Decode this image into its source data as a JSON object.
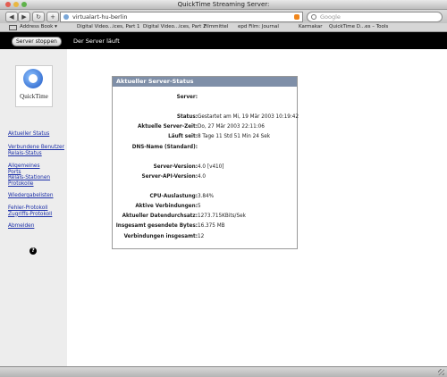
{
  "window": {
    "title": "QuickTime Streaming Server:"
  },
  "toolbar": {
    "back": "◀",
    "forward": "▶",
    "reload": "↻",
    "add": "+",
    "url": "virtualart-hu-berlin",
    "search_placeholder": "Google"
  },
  "bookmarks": [
    "Address Book ▾",
    "Digital Video...ices, Part 1",
    "Digital Video...ices, Part 2",
    "Filmmittel",
    "epd Film: Journal",
    "Karmakar",
    "QuickTime D...es – Tools"
  ],
  "header": {
    "stop_button": "Server stoppen",
    "status_text": "Der Server läuft"
  },
  "sidebar": {
    "logo_text": "QuickTime",
    "links": [
      "Aktueller Status",
      "Verbundene Benutzer",
      "Relais-Status",
      "Allgemeines",
      "Ports",
      "Relais-Stationen",
      "Protokolle",
      "Wiedergabelisten",
      "Fehler-Protokoll",
      "Zugriffs-Protokoll",
      "Abmelden"
    ],
    "help": "?"
  },
  "panel": {
    "title": "Aktueller Server-Status",
    "rows": [
      {
        "label": "Server:",
        "value": ""
      },
      {
        "label": "Status:",
        "value": "Gestartet am Mi, 19 Mär 2003 10:19:42"
      },
      {
        "label": "Aktuelle Server-Zeit:",
        "value": "Do, 27 Mär 2003 22:11:06"
      },
      {
        "label": "Läuft seit:",
        "value": "8 Tage 11 Std 51 Min 24 Sek"
      },
      {
        "label": "DNS-Name (Standard):",
        "value": ""
      },
      {
        "label": "Server-Version:",
        "value": "4.0 [v410]"
      },
      {
        "label": "Server-API-Version:",
        "value": "4.0"
      },
      {
        "label": "CPU-Auslastung:",
        "value": "3.84%"
      },
      {
        "label": "Aktive Verbindungen:",
        "value": "5"
      },
      {
        "label": "Aktueller Datendurchsatz:",
        "value": "1273.715KBits/Sek"
      },
      {
        "label": "Insgesamt gesendete Bytes:",
        "value": "16.375 MB"
      },
      {
        "label": "Verbindungen insgesamt:",
        "value": "12"
      }
    ]
  },
  "colors": {
    "header_bg": "#000000",
    "panel_head": "#7f8fa8",
    "link": "#1a2ea8"
  }
}
